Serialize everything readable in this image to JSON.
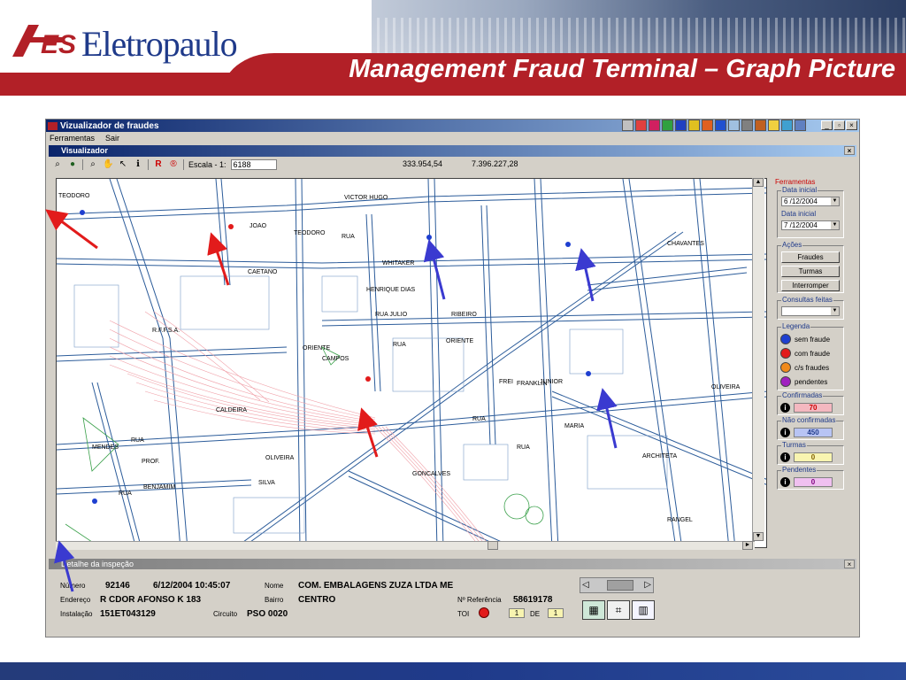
{
  "header": {
    "brand": "Eletropaulo",
    "title": "Management Fraud Terminal – Graph Picture"
  },
  "app": {
    "title": "Vizualizador de fraudes",
    "menu": [
      "Ferramentas",
      "Sair"
    ]
  },
  "viewer": {
    "title": "Visualizador",
    "scale_label": "Escala - 1:",
    "scale_value": "6188",
    "coord_x": "333.954,54",
    "coord_y": "7.396.227,28",
    "toolbar_r": "R"
  },
  "map_labels": [
    "TEODORO",
    "VICTOR HUGO",
    "JOAO",
    "TEODORO",
    "RUA",
    "CAETANO",
    "WHITAKER",
    "HENRIQUE DIAS",
    "RUA JULIO",
    "RIBEIRO",
    "ORIENTE",
    "ORIENTE",
    "RUA",
    "R.F.F.S.A.",
    "CALDEIRA",
    "OLIVEIRA",
    "SILVA",
    "BENJAMIM",
    "RUA",
    "FRANKLIN",
    "CHAVANTES",
    "OLIVEIRA",
    "ARCHITETA",
    "MARIA",
    "MENDES",
    "RUA",
    "PROF.",
    "CAMPOS",
    "FREI",
    "JUNIOR",
    "RUA",
    "RUA",
    "GONCALVES",
    "RANGEL"
  ],
  "panel": {
    "ferramentas": "Ferramentas",
    "data_inicial_label": "Data inicial",
    "data_inicial_value": "6 /12/2004",
    "data_final_label": "Data inicial",
    "data_final_value": "7 /12/2004",
    "acoes": "Ações",
    "btn_fraudes": "Fraudes",
    "btn_turmas": "Turmas",
    "btn_interromper": "Interromper",
    "consultas": "Consultas feitas",
    "legenda": "Legenda",
    "legend": [
      {
        "label": "sem fraude",
        "color": "#1e3fd0"
      },
      {
        "label": "com fraude",
        "color": "#e21b1b"
      },
      {
        "label": "c/s fraudes",
        "color": "#f08a1c"
      },
      {
        "label": "pendentes",
        "color": "#a020c0"
      }
    ],
    "confirmadas_label": "Confirmadas",
    "confirmadas_value": "70",
    "nao_confirmadas_label": "Não confirmadas",
    "nao_confirmadas_value": "450",
    "turmas_label": "Turmas",
    "turmas_value": "0",
    "pendentes_label": "Pendentes",
    "pendentes_value": "0"
  },
  "detail": {
    "title": "Detalhe da inspeção",
    "numero_label": "Número",
    "numero_value": "92146",
    "data_value": "6/12/2004 10:45:07",
    "nome_label": "Nome",
    "nome_value": "COM. EMBALAGENS ZUZA LTDA ME",
    "endereco_label": "Endereço",
    "endereco_value": "R CDOR AFONSO K 183",
    "bairro_label": "Bairro",
    "bairro_value": "CENTRO",
    "ref_label": "Nº Referência",
    "ref_value": "58619178",
    "instalacao_label": "Instalação",
    "instalacao_value": "151ET043129",
    "circuito_label": "Circuito",
    "circuito_value": "PSO  0020",
    "toi_label": "TOI",
    "toi_value": "1",
    "de_label": "DE",
    "de_value": "1"
  },
  "colors": {
    "brand_blue": "#1f3a8a",
    "brand_red": "#b22027",
    "street_blue": "#2c5c9a",
    "rail_pink": "#f0a0a8",
    "park_green": "#3aa04a",
    "arrow_red": "#e21b1b",
    "arrow_blue": "#3a3ad0"
  }
}
